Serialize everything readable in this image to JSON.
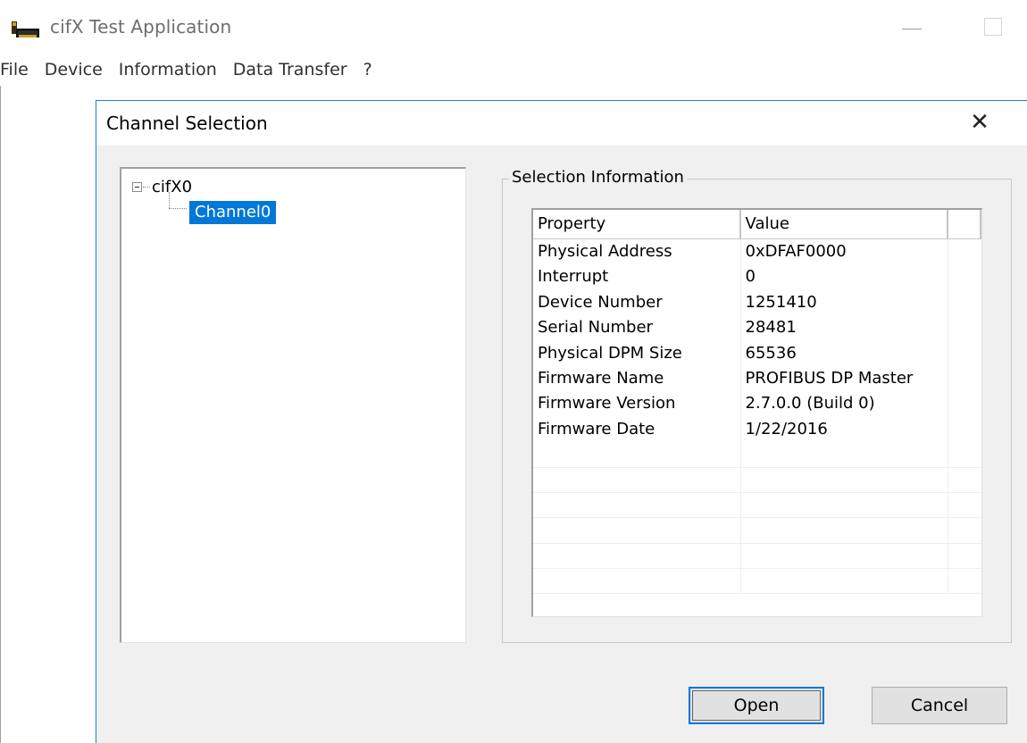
{
  "app": {
    "title": "cifX Test Application",
    "icon": "cifx-app-icon"
  },
  "menubar": {
    "items": [
      "File",
      "Device",
      "Information",
      "Data Transfer",
      "?"
    ]
  },
  "dialog": {
    "title": "Channel Selection",
    "close_glyph": "✕",
    "tree": {
      "root": "cifX0",
      "child": "Channel0",
      "expander": "collapse-icon"
    },
    "group_label": "Selection Information",
    "table": {
      "headers": [
        "Property",
        "Value",
        ""
      ],
      "rows": [
        [
          "Physical Address",
          "0xDFAF0000"
        ],
        [
          "Interrupt",
          "0"
        ],
        [
          "Device Number",
          "1251410"
        ],
        [
          "Serial Number",
          "28481"
        ],
        [
          "Physical DPM Size",
          "65536"
        ],
        [
          "Firmware Name",
          "PROFIBUS DP Master"
        ],
        [
          "Firmware Version",
          "2.7.0.0 (Build 0)"
        ],
        [
          "Firmware Date",
          "1/22/2016"
        ]
      ],
      "empty_rows": 6
    },
    "buttons": {
      "open": "Open",
      "cancel": "Cancel"
    }
  },
  "colors": {
    "accent": "#0078d7",
    "dialog_border": "#1883d7",
    "dialog_bg": "#f0f0f0"
  }
}
